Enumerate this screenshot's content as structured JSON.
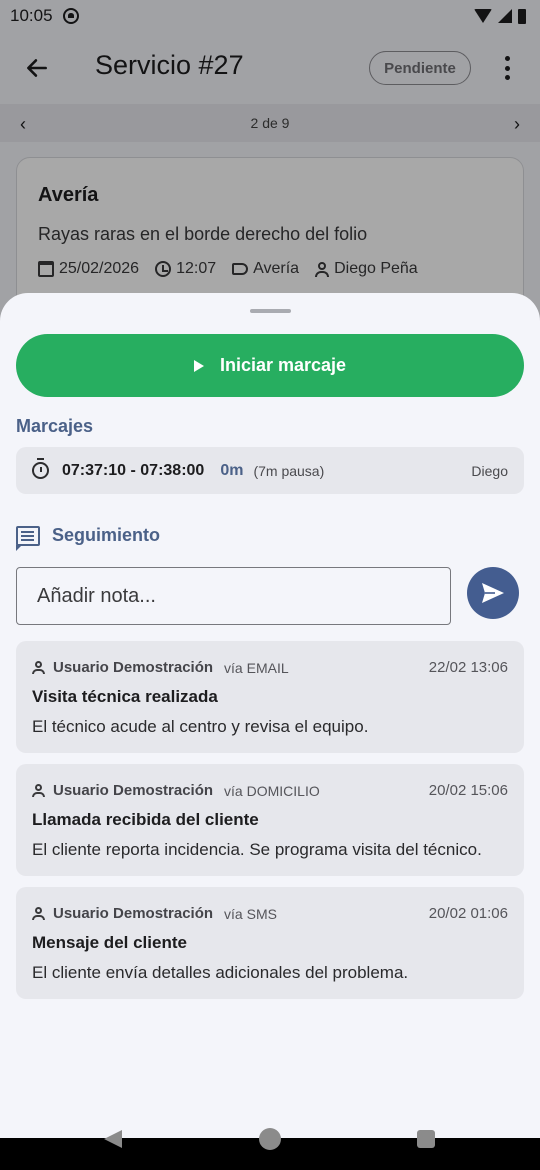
{
  "status_bar": {
    "time": "10:05"
  },
  "app_bar": {
    "title": "Servicio #27",
    "status_chip": "Pendiente"
  },
  "pager": {
    "prev": "‹",
    "text": "2 de 9",
    "next": "›"
  },
  "service_card": {
    "title": "Avería",
    "description": "Rayas raras en el borde derecho del folio",
    "date": "25/02/2026",
    "time": "12:07",
    "category": "Avería",
    "assignee": "Diego Peña"
  },
  "sheet": {
    "start_button": "Iniciar marcaje",
    "marcajes_title": "Marcajes",
    "marcajes": [
      {
        "range": "07:37:10 - 07:38:00",
        "duration": "0m",
        "pause": "(7m pausa)",
        "user": "Diego"
      }
    ],
    "seguimiento_title": "Seguimiento",
    "note_placeholder": "Añadir nota...",
    "notes": [
      {
        "user": "Usuario Demostración",
        "via": "vía EMAIL",
        "date": "22/02 13:06",
        "title": "Visita técnica realizada",
        "body": "El técnico acude al centro y revisa el equipo."
      },
      {
        "user": "Usuario Demostración",
        "via": "vía DOMICILIO",
        "date": "20/02 15:06",
        "title": "Llamada recibida del cliente",
        "body": "El cliente reporta incidencia. Se programa visita del técnico."
      },
      {
        "user": "Usuario Demostración",
        "via": "vía SMS",
        "date": "20/02 01:06",
        "title": "Mensaje del cliente",
        "body": "El cliente envía detalles adicionales del problema."
      }
    ]
  },
  "colors": {
    "primary": "#445d90",
    "success": "#27ae60",
    "section": "#4b6188"
  },
  "icons": {
    "back": "arrow-left-icon",
    "more": "more-vert-icon",
    "play": "play-icon",
    "timer": "timer-icon",
    "chat": "chat-icon",
    "send": "send-icon",
    "person": "person-icon"
  }
}
